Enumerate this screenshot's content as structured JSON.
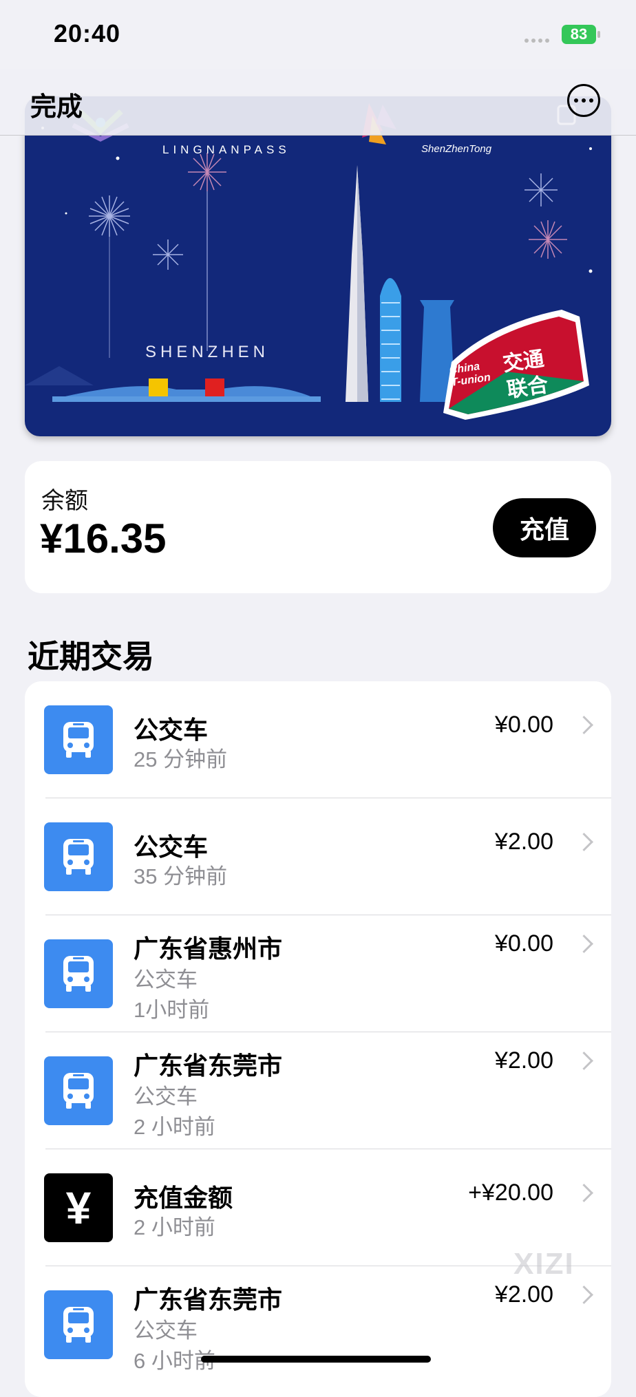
{
  "status_bar": {
    "time": "20:40",
    "battery": "83"
  },
  "nav": {
    "done_label": "完成",
    "more_icon": "ellipsis-circle-icon"
  },
  "card": {
    "logo_left_text": "LINGNANPASS",
    "logo_right_text": "ShenZhenTong",
    "city_label": "SHENZHEN",
    "badge_en": "China\nT-union",
    "badge_cn_top": "交通",
    "badge_cn_bottom": "联合",
    "colors": {
      "background": "#12287a",
      "badge": "#c8102e"
    }
  },
  "balance": {
    "label": "余额",
    "amount": "¥16.35",
    "recharge_label": "充值"
  },
  "section_title": "近期交易",
  "transactions": [
    {
      "icon": "bus-icon",
      "title": "公交车",
      "lines": [
        "25 分钟前"
      ],
      "amount": "¥0.00"
    },
    {
      "icon": "bus-icon",
      "title": "公交车",
      "lines": [
        "35 分钟前"
      ],
      "amount": "¥2.00"
    },
    {
      "icon": "bus-icon",
      "title": "广东省惠州市",
      "lines": [
        "公交车",
        "1小时前"
      ],
      "amount": "¥0.00"
    },
    {
      "icon": "bus-icon",
      "title": "广东省东莞市",
      "lines": [
        "公交车",
        "2 小时前"
      ],
      "amount": "¥2.00"
    },
    {
      "icon": "yen-icon",
      "title": "充值金额",
      "lines": [
        "2 小时前"
      ],
      "amount": "+¥20.00"
    },
    {
      "icon": "bus-icon",
      "title": "广东省东莞市",
      "lines": [
        "公交车",
        "6 小时前"
      ],
      "amount": "¥2.00"
    }
  ],
  "watermark": "XIZI",
  "colors": {
    "accent_blue": "#3d8bf0",
    "battery_green": "#34c759"
  }
}
